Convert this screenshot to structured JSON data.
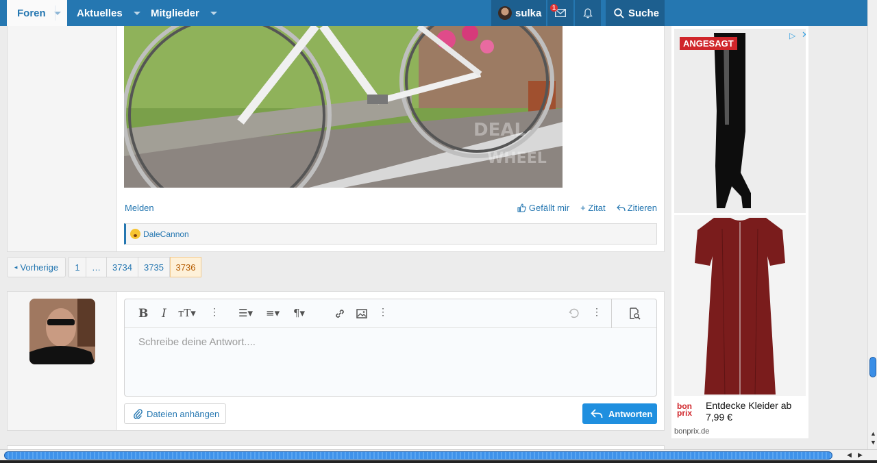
{
  "nav": {
    "tabs": [
      {
        "label": "Foren",
        "active": true
      },
      {
        "label": "Aktuelles",
        "active": false
      },
      {
        "label": "Mitglieder",
        "active": false
      }
    ],
    "user": "sulka",
    "inbox_badge": "1",
    "search_label": "Suche"
  },
  "post": {
    "report_label": "Melden",
    "like_label": "Gefällt mir",
    "quote_add_label": "+ Zitat",
    "quote_label": "Zitieren",
    "reaction_user": "DaleCannon"
  },
  "pagination": {
    "prev_label": "Vorherige",
    "pages": [
      "1",
      "…",
      "3734",
      "3735",
      "3736"
    ],
    "current": "3736"
  },
  "editor": {
    "placeholder": "Schreibe deine Antwort....",
    "attach_label": "Dateien anhängen",
    "reply_label": "Antworten",
    "toolbar_icons": [
      "bold-icon",
      "italic-icon",
      "text-size-icon",
      "more-icon",
      "list-icon",
      "align-icon",
      "paragraph-icon",
      "link-icon",
      "image-icon",
      "more-icon",
      "undo-icon",
      "more-icon",
      "preview-icon"
    ]
  },
  "ad": {
    "badge": "ANGESAGT",
    "text": "Entdecke Kleider ab 7,99 €",
    "logo_line1": "bon",
    "logo_line2": "prix",
    "domain": "bonprix.de"
  },
  "colors": {
    "nav": "#2577b1",
    "accent": "#1f8fdf",
    "current_page": "#fef1d9"
  }
}
